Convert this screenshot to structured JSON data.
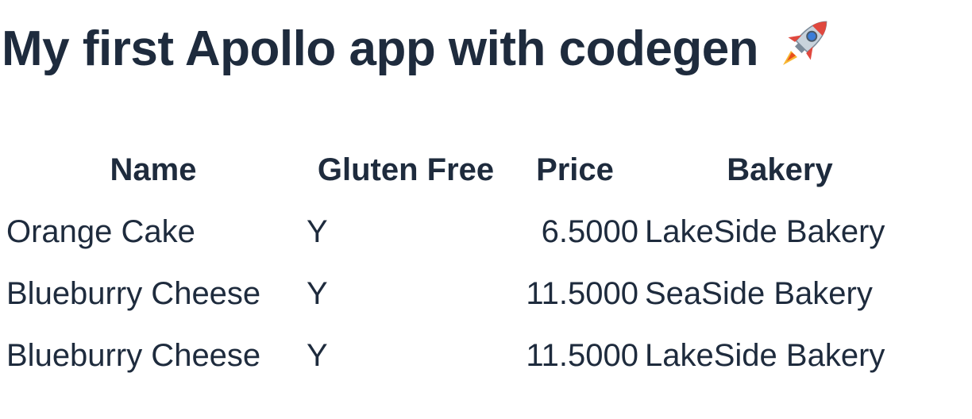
{
  "header": {
    "title": "My first Apollo app with codegen",
    "title_icon": "rocket-icon"
  },
  "table": {
    "columns": [
      "Name",
      "Gluten Free",
      "Price",
      "Bakery"
    ],
    "rows": [
      {
        "name": "Orange Cake",
        "gluten_free": "Y",
        "price": "6.5000",
        "bakery": "LakeSide Bakery"
      },
      {
        "name": "Blueburry Cheese",
        "gluten_free": "Y",
        "price": "11.5000",
        "bakery": "SeaSide Bakery"
      },
      {
        "name": "Blueburry Cheese",
        "gluten_free": "Y",
        "price": "11.5000",
        "bakery": "LakeSide Bakery"
      }
    ]
  },
  "colors": {
    "text": "#1e2b3d",
    "background": "#ffffff"
  }
}
